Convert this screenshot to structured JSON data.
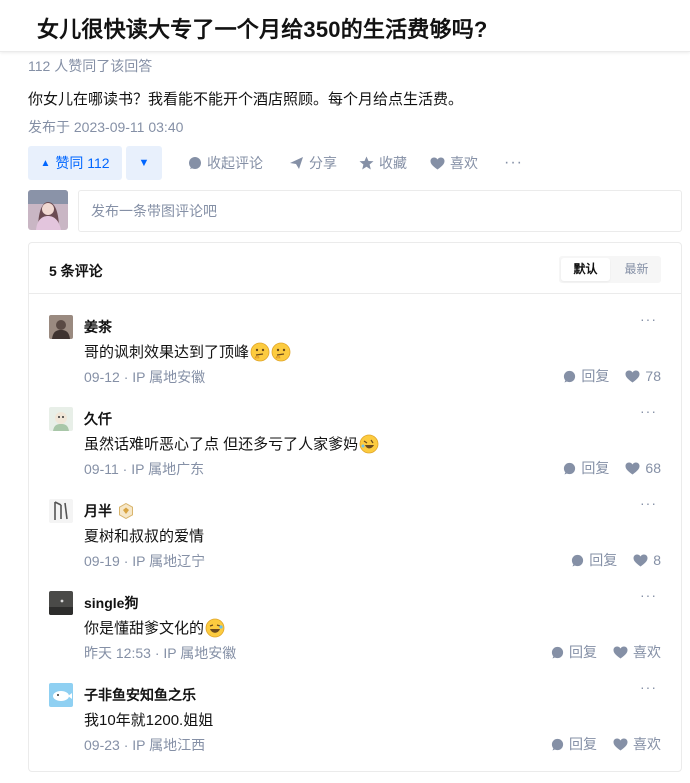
{
  "question": {
    "title": "女儿很快读大专了一个月给350的生活费够吗?"
  },
  "answer": {
    "vote_meta": "112 人赞同了该回答",
    "content": "你女儿在哪读书？我看能不能开个酒店照顾。每个月给点生活费。",
    "published": "发布于 2023-09-11 03:40"
  },
  "actions": {
    "upvote_label": "赞同 112",
    "collapse_label": "收起评论",
    "share_label": "分享",
    "favorite_label": "收藏",
    "like_label": "喜欢",
    "more": "···"
  },
  "comment_input": {
    "placeholder": "发布一条带图评论吧"
  },
  "comments": {
    "count_label": "5 条评论",
    "sort": {
      "default": "默认",
      "latest": "最新",
      "active": "默认"
    },
    "items": [
      {
        "name": "姜茶",
        "text": "哥的讽刺效果达到了顶峰",
        "emoji": [
          "thinking-face",
          "thinking-face"
        ],
        "date": "09-12",
        "ip": "IP 属地安徽",
        "reply": "回复",
        "likes": "78",
        "more": "···"
      },
      {
        "name": "久仟",
        "text": "虽然话难听恶心了点 但还多亏了人家爹妈",
        "emoji": [
          "rofl-face"
        ],
        "date": "09-11",
        "ip": "IP 属地广东",
        "reply": "回复",
        "likes": "68",
        "more": "···"
      },
      {
        "name": "月半",
        "text": "夏树和叔叔的爱情",
        "emoji": [],
        "date": "09-19",
        "ip": "IP 属地辽宁",
        "reply": "回复",
        "likes": "8",
        "more": "···",
        "badge": "level-badge"
      },
      {
        "name": "single狗",
        "text": "你是懂甜爹文化的",
        "emoji": [
          "laughing-face"
        ],
        "date": "昨天 12:53",
        "ip": "IP 属地安徽",
        "reply": "回复",
        "likes": "喜欢",
        "more": "···"
      },
      {
        "name": "子非鱼安知鱼之乐",
        "text": "我10年就1200.姐姐",
        "emoji": [],
        "date": "09-23",
        "ip": "IP 属地江西",
        "reply": "回复",
        "likes": "喜欢",
        "more": "···"
      }
    ]
  },
  "colors": {
    "brand": "#0066ff",
    "brand_bg": "#e8f0fc",
    "muted": "#8590a6",
    "text": "#121212"
  },
  "icons": [
    "comment-icon",
    "share-icon",
    "star-icon",
    "heart-icon",
    "reply-icon",
    "thinking-face",
    "rofl-face",
    "laughing-face",
    "level-badge"
  ]
}
